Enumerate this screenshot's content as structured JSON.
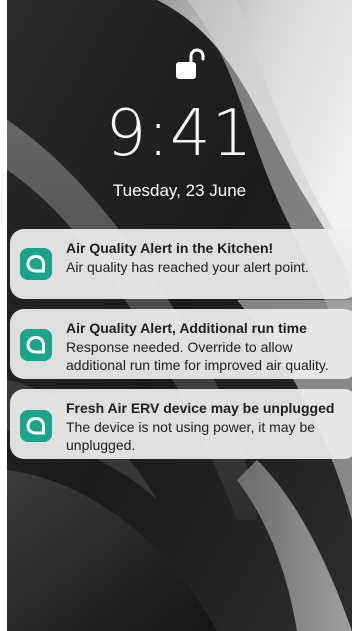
{
  "lockscreen": {
    "time": "9:41",
    "date": "Tuesday,  23 June",
    "lock_icon": "unlocked-padlock-icon"
  },
  "notifications": [
    {
      "app_icon": "speech-bubble-icon",
      "title": "Air Quality Alert in the Kitchen!",
      "body": "Air quality has reached your alert point."
    },
    {
      "app_icon": "speech-bubble-icon",
      "title": "Air Quality Alert, Additional run time",
      "body": "Response needed. Override to allow additional run time for improved air quality."
    },
    {
      "app_icon": "speech-bubble-icon",
      "title": "Fresh Air ERV device may be unplugged",
      "body": "The device is not using power, it may be unplugged."
    }
  ],
  "colors": {
    "app_icon_accent": "#1aa58a",
    "notification_background": "#eeeeee",
    "wallpaper_dark": "#1f1f1f"
  }
}
